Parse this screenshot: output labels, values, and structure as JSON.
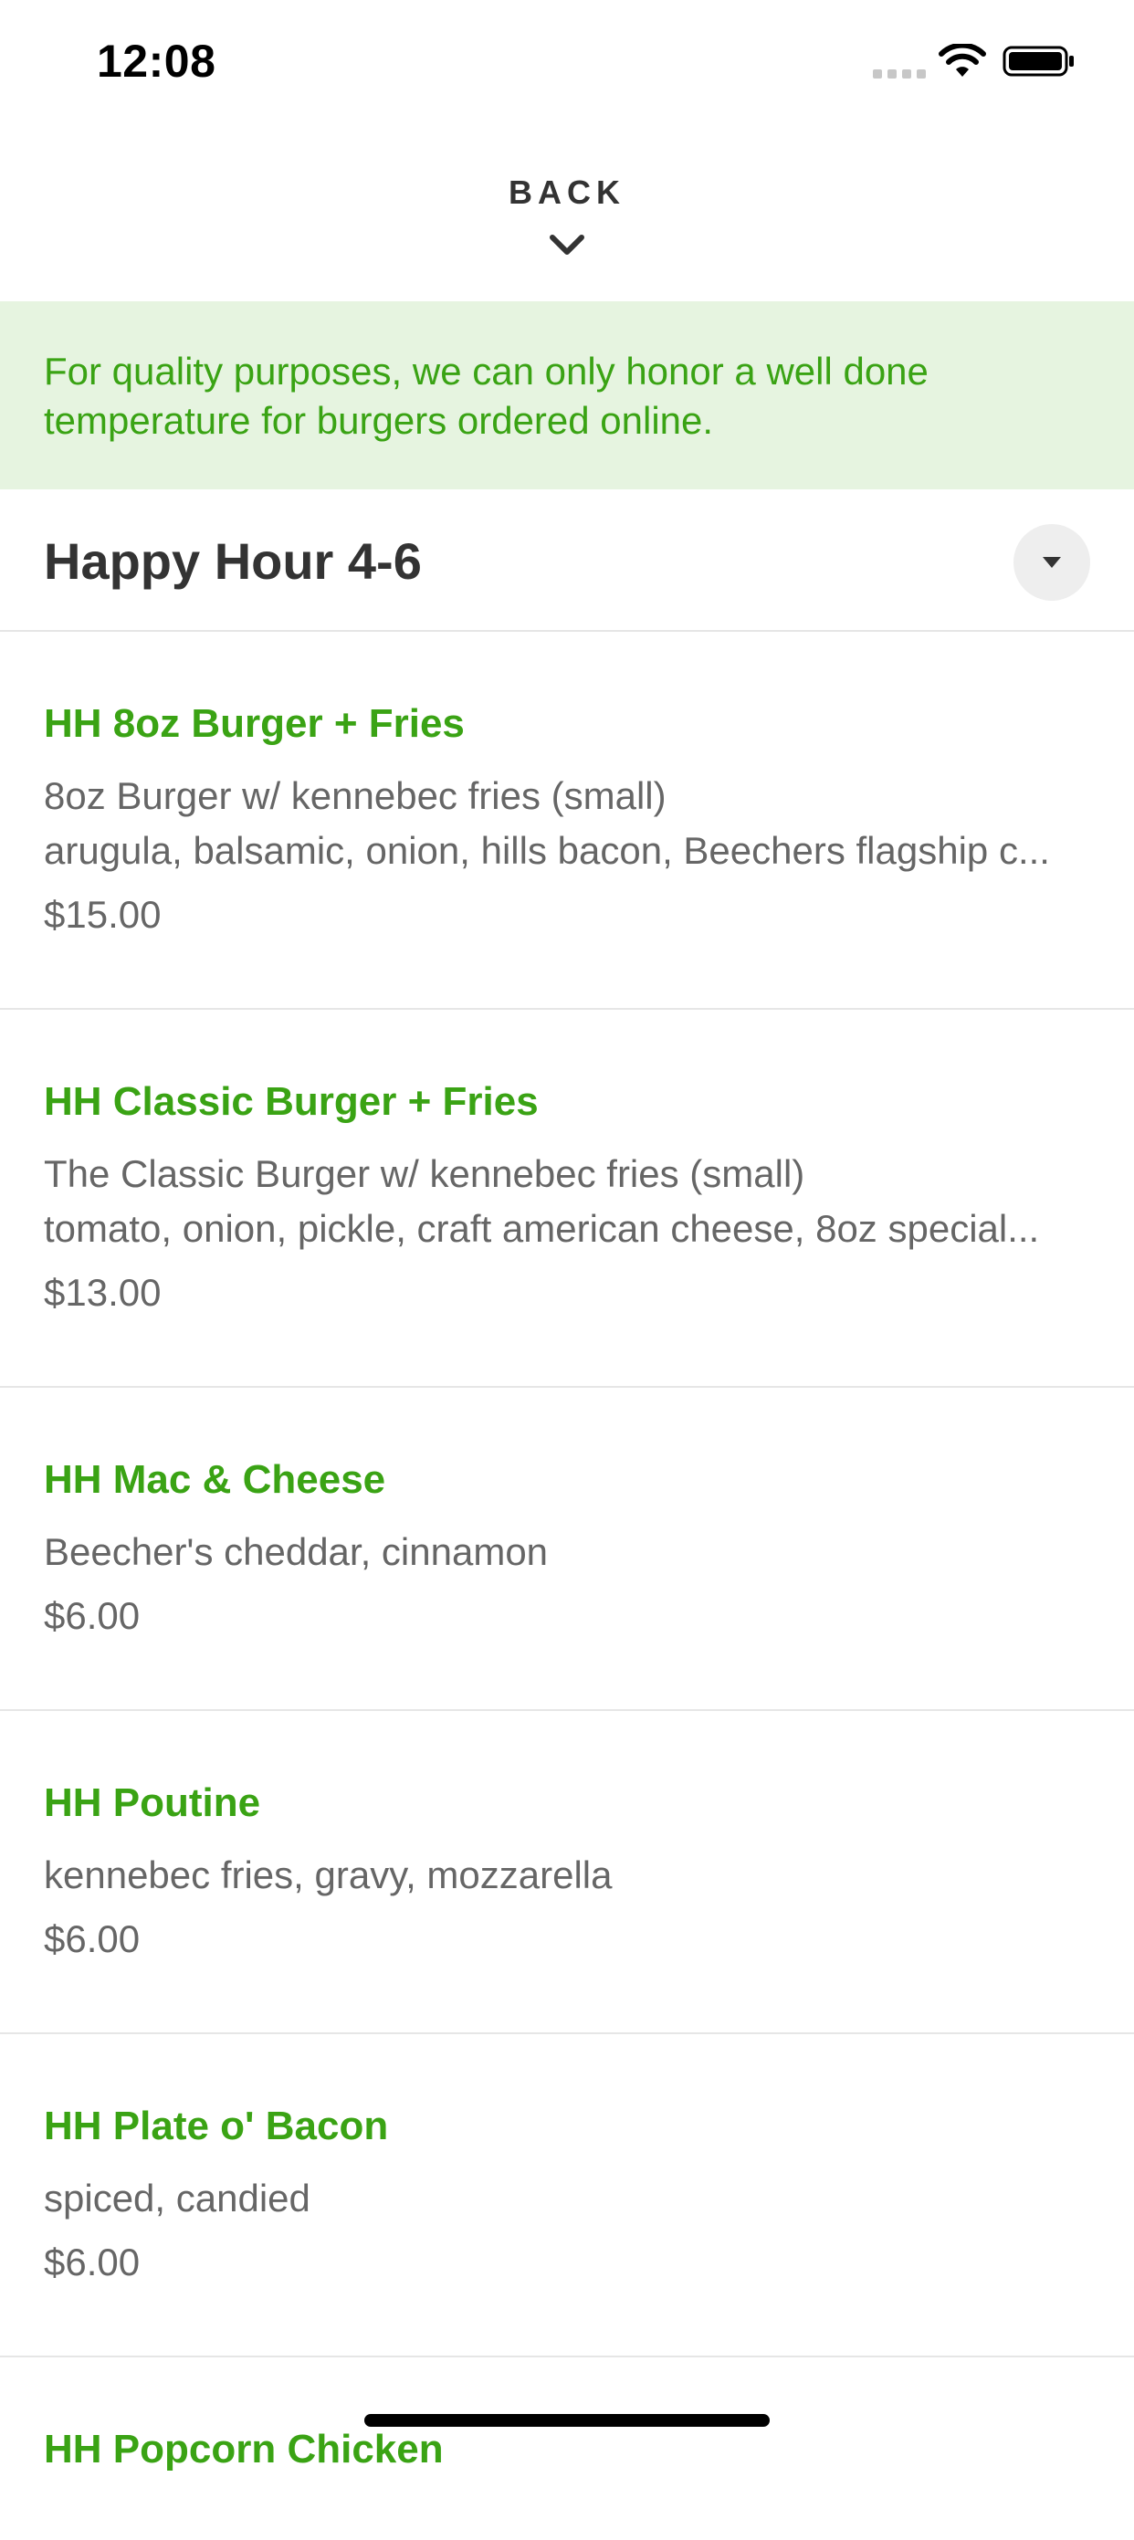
{
  "status_bar": {
    "time": "12:08",
    "signal_icon": "signal-icon",
    "wifi_icon": "wifi-icon",
    "battery_icon": "battery-icon"
  },
  "header": {
    "back_label": "BACK",
    "chevron_icon": "chevron-down-icon"
  },
  "notice": {
    "text": "For quality purposes, we can only honor a well done temperature for burgers ordered online."
  },
  "section": {
    "title": "Happy Hour 4-6",
    "toggle_icon": "caret-down-icon"
  },
  "menu_items": [
    {
      "name": "HH 8oz Burger + Fries",
      "desc_line1": "8oz Burger w/ kennebec fries (small)",
      "desc_line2": "arugula, balsamic, onion, hills bacon, Beechers flagship c...",
      "price": "$15.00"
    },
    {
      "name": "HH Classic Burger + Fries",
      "desc_line1": "The Classic Burger w/ kennebec fries (small)",
      "desc_line2": "tomato, onion, pickle, craft american cheese, 8oz special...",
      "price": "$13.00"
    },
    {
      "name": "HH Mac & Cheese",
      "desc_line1": "Beecher's cheddar, cinnamon",
      "price": "$6.00"
    },
    {
      "name": "HH Poutine",
      "desc_line1": "kennebec fries, gravy, mozzarella",
      "price": "$6.00"
    },
    {
      "name": "HH Plate o' Bacon",
      "desc_line1": "spiced, candied",
      "price": "$6.00"
    },
    {
      "name": "HH Popcorn Chicken"
    }
  ],
  "colors": {
    "accent_green": "#3aa314",
    "notice_background": "#e6f4e0",
    "text_dark": "#333333",
    "text_muted": "#666666"
  }
}
